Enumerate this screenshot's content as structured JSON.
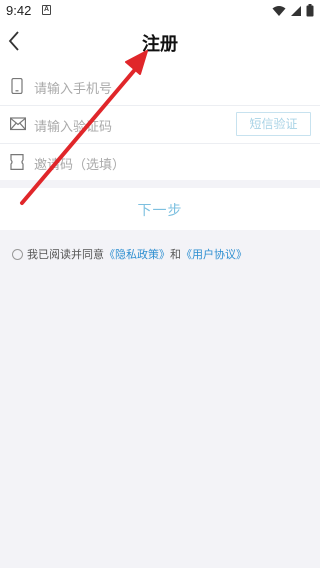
{
  "status_bar": {
    "time": "9:42",
    "notification_letter": "A"
  },
  "header": {
    "title": "注册"
  },
  "form": {
    "phone_placeholder": "请输入手机号",
    "code_placeholder": "请输入验证码",
    "sms_button": "短信验证",
    "invite_placeholder": "邀请码（选填）"
  },
  "next_button": "下一步",
  "agreement": {
    "prefix": "我已阅读并同意",
    "privacy_link": "《隐私政策》",
    "conjunction": "和",
    "user_link": "《用户协议》"
  },
  "colors": {
    "accent": "#2e8fd1",
    "light_accent": "#7dc0e0",
    "arrow": "#e0262a"
  },
  "icons": [
    "phone-icon",
    "envelope-icon",
    "ticket-icon",
    "back-arrow-icon",
    "wifi-icon",
    "signal-icon",
    "battery-icon"
  ]
}
